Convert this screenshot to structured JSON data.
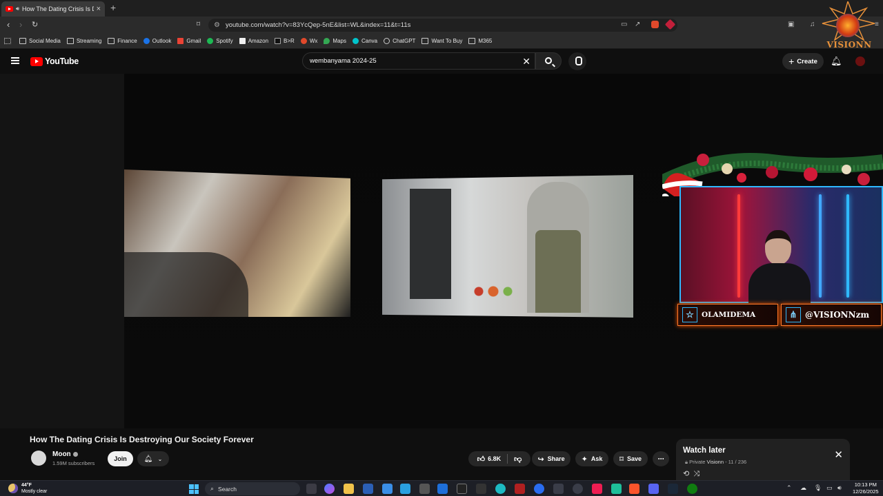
{
  "browser": {
    "tab_title": "How The Dating Crisis Is Destr",
    "tab_close": "×",
    "new_tab": "+",
    "url": "youtube.com/watch?v=83YcQep-5nE&list=WL&index=11&t=11s"
  },
  "bookmarks": [
    {
      "label": "Social Media",
      "icon": "folder-icon"
    },
    {
      "label": "Streaming",
      "icon": "folder-icon"
    },
    {
      "label": "Finance",
      "icon": "folder-icon"
    },
    {
      "label": "Outlook",
      "icon": "outlook-icon"
    },
    {
      "label": "Gmail",
      "icon": "gmail-icon"
    },
    {
      "label": "Spotify",
      "icon": "spotify-icon"
    },
    {
      "label": "Amazon",
      "icon": "amazon-icon"
    },
    {
      "label": "B>R",
      "icon": "br-icon"
    },
    {
      "label": "Wx",
      "icon": "wx-icon"
    },
    {
      "label": "Maps",
      "icon": "maps-icon"
    },
    {
      "label": "Canva",
      "icon": "canva-icon"
    },
    {
      "label": "ChatGPT",
      "icon": "chatgpt-icon"
    },
    {
      "label": "Want To Buy",
      "icon": "folder-icon"
    },
    {
      "label": "M365",
      "icon": "folder-icon"
    }
  ],
  "youtube": {
    "logo_text": "YouTube",
    "search_value": "wembanyama 2024-25",
    "create_label": "Create"
  },
  "overlay": {
    "name_left": "OLAMIDEMA",
    "name_right": "@VISIONNzm",
    "watermark": "VISIONN"
  },
  "video": {
    "title": "How The Dating Crisis Is Destroying Our Society Forever",
    "channel": "Moon",
    "subscribers": "1.59M subscribers",
    "join_label": "Join",
    "likes": "6.8K",
    "share_label": "Share",
    "ask_label": "Ask",
    "save_label": "Save"
  },
  "watch_later": {
    "title": "Watch later",
    "privacy": "Private",
    "owner": "Visionn",
    "position": "- 11 / 236"
  },
  "taskbar": {
    "temp": "44°F",
    "condition": "Mostly clear",
    "search_label": "Search",
    "time": "10:13 PM",
    "date": "12/26/2025"
  },
  "colors": {
    "yt_red": "#ff0000",
    "neon_blue": "#2fb9ff",
    "fire_orange": "#ff7a2a"
  }
}
